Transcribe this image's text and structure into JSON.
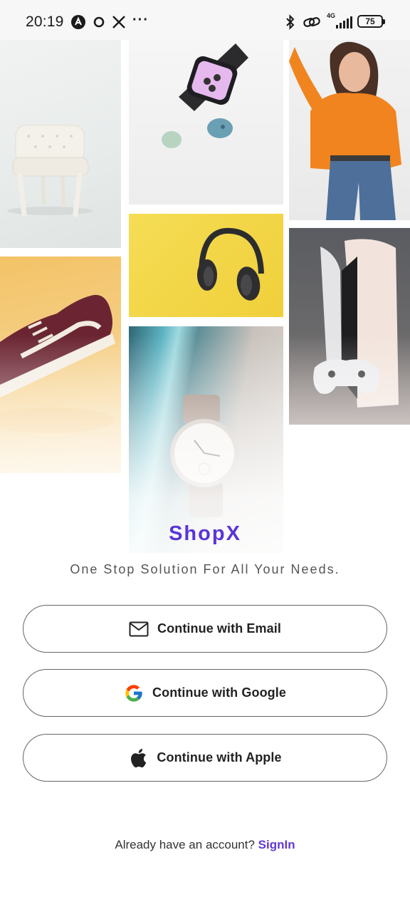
{
  "status_bar": {
    "time": "20:19",
    "overflow": "···",
    "network": "4G",
    "battery": "75",
    "left_icons": [
      "a-badge-icon",
      "ring-icon",
      "x-logo-icon"
    ],
    "right_icons": [
      "bluetooth-icon",
      "link-icon",
      "signal-icon",
      "battery-icon"
    ]
  },
  "collage": {
    "images": [
      "chair",
      "smartwatch",
      "woman-orange-sweater",
      "headphones",
      "ps5-console",
      "sneaker",
      "wristwatch"
    ]
  },
  "brand": {
    "name": "ShopX",
    "tagline": "One Stop Solution For All Your Needs.",
    "color": "#5a34d8"
  },
  "auth": {
    "email_label": "Continue with Email",
    "google_label": "Continue with Google",
    "apple_label": "Continue with Apple"
  },
  "footer": {
    "prompt": "Already have an account? ",
    "link": "SignIn",
    "link_color": "#6339d3"
  }
}
